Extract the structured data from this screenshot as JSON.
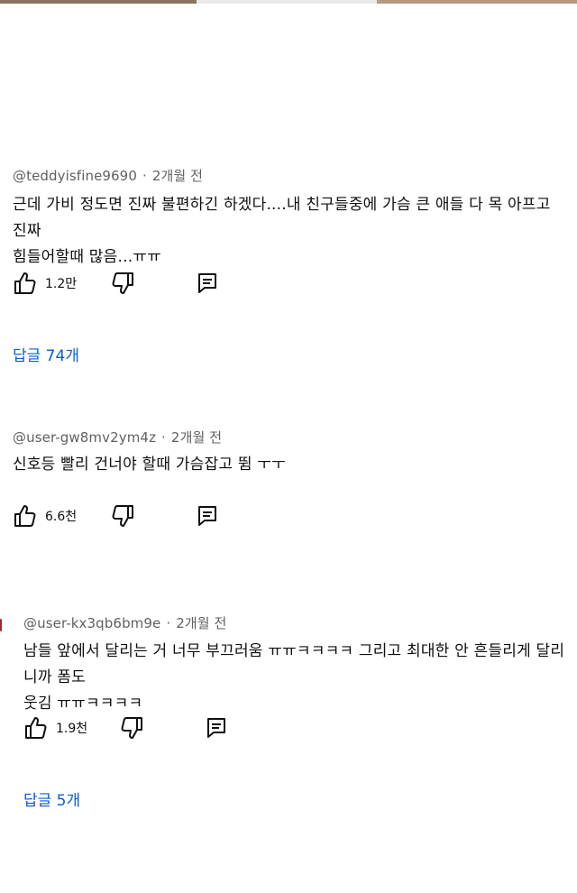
{
  "comments": [
    {
      "author": "@teddyisfine9690",
      "time": "2개월 전",
      "text_line1": "근데 가비 정도면 진짜 불편하긴 하겠다....내 친구들중에 가슴 큰 애들 다 목 아프고 진짜",
      "text_line2": "힘들어할때 많음...ㅠㅠ",
      "likes": "1.2만",
      "replies": "답글 74개"
    },
    {
      "author": "@user-gw8mv2ym4z",
      "time": "2개월 전",
      "text_line1": "신호등 빨리 건너야 할때 가슴잡고 뜀 ㅜㅜ",
      "likes": "6.6천"
    },
    {
      "author": "@user-kx3qb6bm9e",
      "time": "2개월 전",
      "text_line1": "남들 앞에서 달리는 거 너무 부끄러움 ㅠㅠㅋㅋㅋㅋ 그리고 최대한 안 흔들리게 달리니까 폼도",
      "text_line2": "웃김 ㅠㅠㅋㅋㅋㅋ",
      "likes": "1.9천",
      "replies": "답글 5개"
    }
  ],
  "icons": {
    "like": "thumbs-up-icon",
    "dislike": "thumbs-down-icon",
    "reply": "reply-comment-icon"
  },
  "colors": {
    "link": "#065fd4",
    "meta": "#606060",
    "text": "#0f0f0f"
  }
}
